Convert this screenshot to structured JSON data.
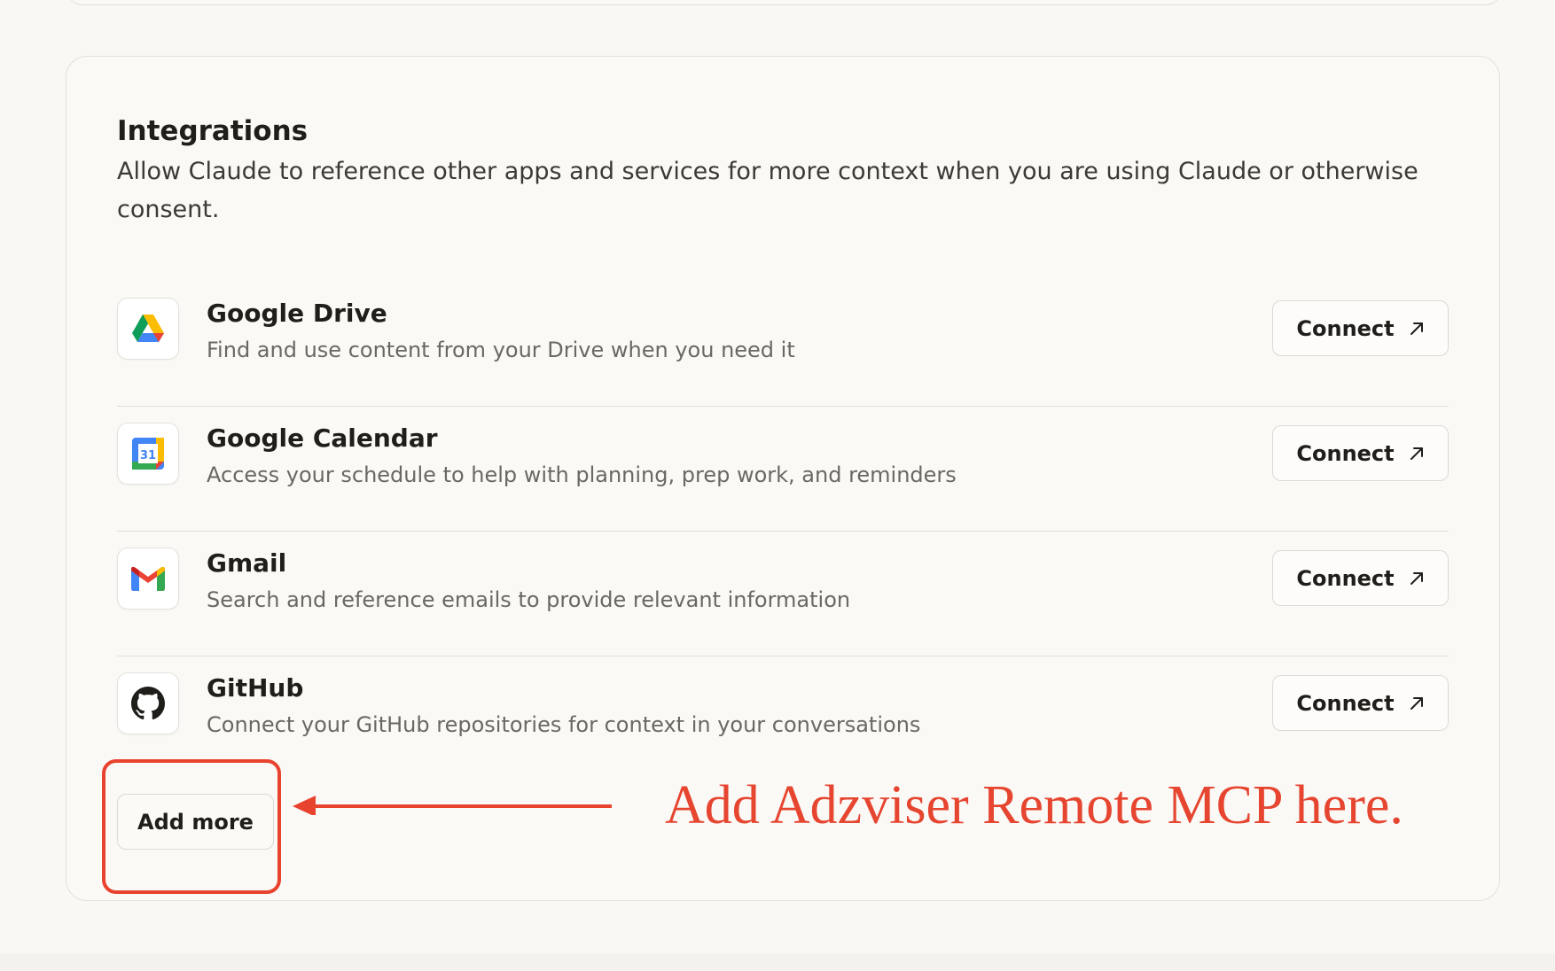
{
  "integrations": {
    "title": "Integrations",
    "description": "Allow Claude to reference other apps and services for more context when you are using Claude or otherwise consent.",
    "items": [
      {
        "name": "Google Drive",
        "description": "Find and use content from your Drive when you need it",
        "icon": "google-drive-icon",
        "action_label": "Connect"
      },
      {
        "name": "Google Calendar",
        "description": "Access your schedule to help with planning, prep work, and reminders",
        "icon": "google-calendar-icon",
        "calendar_day": "31",
        "action_label": "Connect"
      },
      {
        "name": "Gmail",
        "description": "Search and reference emails to provide relevant information",
        "icon": "gmail-icon",
        "action_label": "Connect"
      },
      {
        "name": "GitHub",
        "description": "Connect your GitHub repositories for context in your conversations",
        "icon": "github-icon",
        "action_label": "Connect"
      }
    ],
    "add_more_label": "Add more"
  },
  "annotation": {
    "text": "Add Adzviser Remote MCP here.",
    "color": "#e8432e"
  },
  "colors": {
    "background": "#f9f8f5",
    "card_background": "#faf9f6",
    "border": "#e3e1db",
    "primary_text": "#1f1e1b",
    "secondary_text": "#6a6862",
    "annotation": "#e8432e"
  }
}
